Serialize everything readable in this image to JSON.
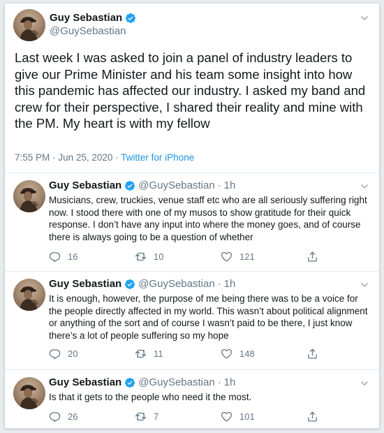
{
  "main_tweet": {
    "display_name": "Guy Sebastian",
    "handle": "@GuySebastian",
    "text": "Last week I was asked to join a panel of industry leaders to give our Prime Minister and his team some insight into how this pandemic has affected our industry. I asked my band and crew for their perspective, I shared their reality and mine with the PM. My heart is with my fellow",
    "time": "7:55 PM",
    "date": "Jun 25, 2020",
    "separator": "·",
    "source": "Twitter for iPhone"
  },
  "replies": [
    {
      "display_name": "Guy Sebastian",
      "handle": "@GuySebastian",
      "separator": "·",
      "time_ago": "1h",
      "text": "Musicians, crew, truckies, venue staff etc who are all seriously suffering right now. I stood there with one of my musos to show gratitude for their quick response. I don’t have any input into where the money goes, and of course there is always going to be a question of whether",
      "reply_count": "16",
      "retweet_count": "10",
      "like_count": "121"
    },
    {
      "display_name": "Guy Sebastian",
      "handle": "@GuySebastian",
      "separator": "·",
      "time_ago": "1h",
      "text": "It is enough, however, the purpose of me being there was to be a voice for the people directly affected in my world. This wasn’t about political alignment or anything of the sort and of course I wasn’t paid to be there, I just know there’s a lot of people suffering so my hope",
      "reply_count": "20",
      "retweet_count": "11",
      "like_count": "148"
    },
    {
      "display_name": "Guy Sebastian",
      "handle": "@GuySebastian",
      "separator": "·",
      "time_ago": "1h",
      "text": "Is that it gets to the people who need it the most.",
      "reply_count": "26",
      "retweet_count": "7",
      "like_count": "101"
    }
  ],
  "icons": {
    "verified": "verified-badge-icon",
    "menu": "chevron-down-icon",
    "reply": "reply-icon",
    "retweet": "retweet-icon",
    "like": "heart-icon",
    "share": "share-icon"
  },
  "colors": {
    "text": "#14171a",
    "secondary": "#657786",
    "link": "#1b95e0",
    "verified": "#1da1f2",
    "divider": "#e6ecf0"
  }
}
